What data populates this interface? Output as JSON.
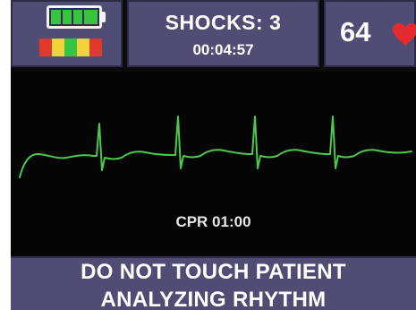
{
  "status": {
    "battery_icon": "battery-full-icon",
    "battery_level": 1.0,
    "indicator_colors": [
      "#e23a2a",
      "#f2d43a",
      "#39c33e",
      "#f2d43a",
      "#e23a2a"
    ]
  },
  "shocks": {
    "label": "SHOCKS: 3",
    "elapsed": "00:04:57"
  },
  "heart_rate": {
    "value": "64",
    "icon": "heart-icon",
    "icon_color": "#e52a2f"
  },
  "ecg": {
    "trace_color": "#4cc94a",
    "cpr_label": "CPR 01:00"
  },
  "message": {
    "line1": "DO NOT TOUCH PATIENT",
    "line2": "ANALYZING RHYTHM"
  }
}
